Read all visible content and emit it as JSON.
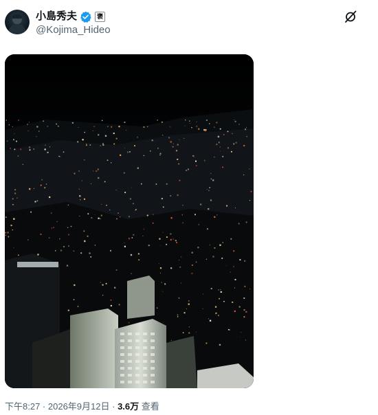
{
  "author": {
    "display_name": "小島秀夫",
    "handle": "@Kojima_Hideo",
    "avatar_icon": "avatar-portrait",
    "verified_icon": "verified-badge-icon",
    "verified_color": "#1d9bf0",
    "affiliate_badge": "褒"
  },
  "actions": {
    "grok_icon": "grok-icon"
  },
  "media": {
    "image_icon": "night-cityscape-photo"
  },
  "meta": {
    "time": "下午8:27",
    "separator1": " · ",
    "date": "2026年9月12日",
    "separator2": " · ",
    "views_count": "3.6万",
    "views_label": " 查看"
  }
}
